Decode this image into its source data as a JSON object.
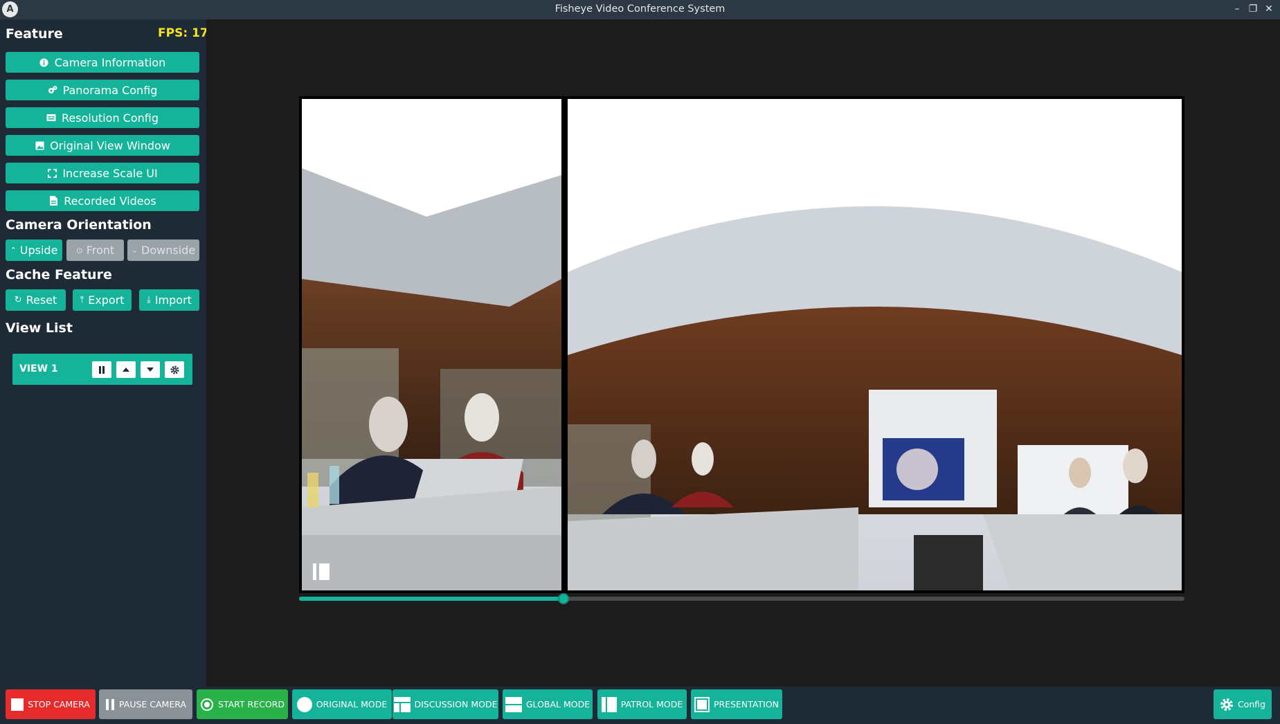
{
  "window": {
    "title": "Fisheye Video Conference System",
    "logo_text": "A",
    "controls": {
      "minimize": "–",
      "restore": "❐",
      "close": "✕"
    }
  },
  "sidebar": {
    "feature_title": "Feature",
    "fps_label": "FPS: 17",
    "feature_buttons": [
      {
        "label": "Camera Information",
        "icon": "info-icon"
      },
      {
        "label": "Panorama Config",
        "icon": "cogs-icon"
      },
      {
        "label": "Resolution Config",
        "icon": "screen-icon"
      },
      {
        "label": "Original View Window",
        "icon": "image-icon"
      },
      {
        "label": "Increase Scale UI",
        "icon": "expand-icon"
      },
      {
        "label": "Recorded Videos",
        "icon": "file-icon"
      }
    ],
    "orientation_title": "Camera Orientation",
    "orientation": [
      {
        "label": "Upside",
        "icon": "chevron-up-icon",
        "state": "active"
      },
      {
        "label": "Front",
        "icon": "circle-icon",
        "state": "disabled"
      },
      {
        "label": "Downside",
        "icon": "chevron-down-icon",
        "state": "disabled"
      }
    ],
    "cache_title": "Cache Feature",
    "cache": [
      {
        "label": "Reset",
        "icon": "refresh-icon"
      },
      {
        "label": "Export",
        "icon": "upload-icon"
      },
      {
        "label": "Import",
        "icon": "download-icon"
      }
    ],
    "view_list_title": "View List",
    "views": [
      {
        "label": "VIEW 1"
      }
    ]
  },
  "player": {
    "progress_fraction": 0.299
  },
  "toolbar": {
    "stop_camera": "STOP CAMERA",
    "pause_camera": "PAUSE CAMERA",
    "start_record": "START RECORD",
    "original_mode": "ORIGINAL MODE",
    "discussion_mode": "DISCUSSION MODE",
    "global_mode": "GLOBAL MODE",
    "patrol_mode": "PATROL MODE",
    "presentation": "PRESENTATION",
    "config": "Config"
  },
  "colors": {
    "accent": "#16b39b",
    "fps": "#f5e41e",
    "stop": "#e52b2b",
    "record": "#29b24a",
    "sidebar_bg": "#1e2a36"
  }
}
